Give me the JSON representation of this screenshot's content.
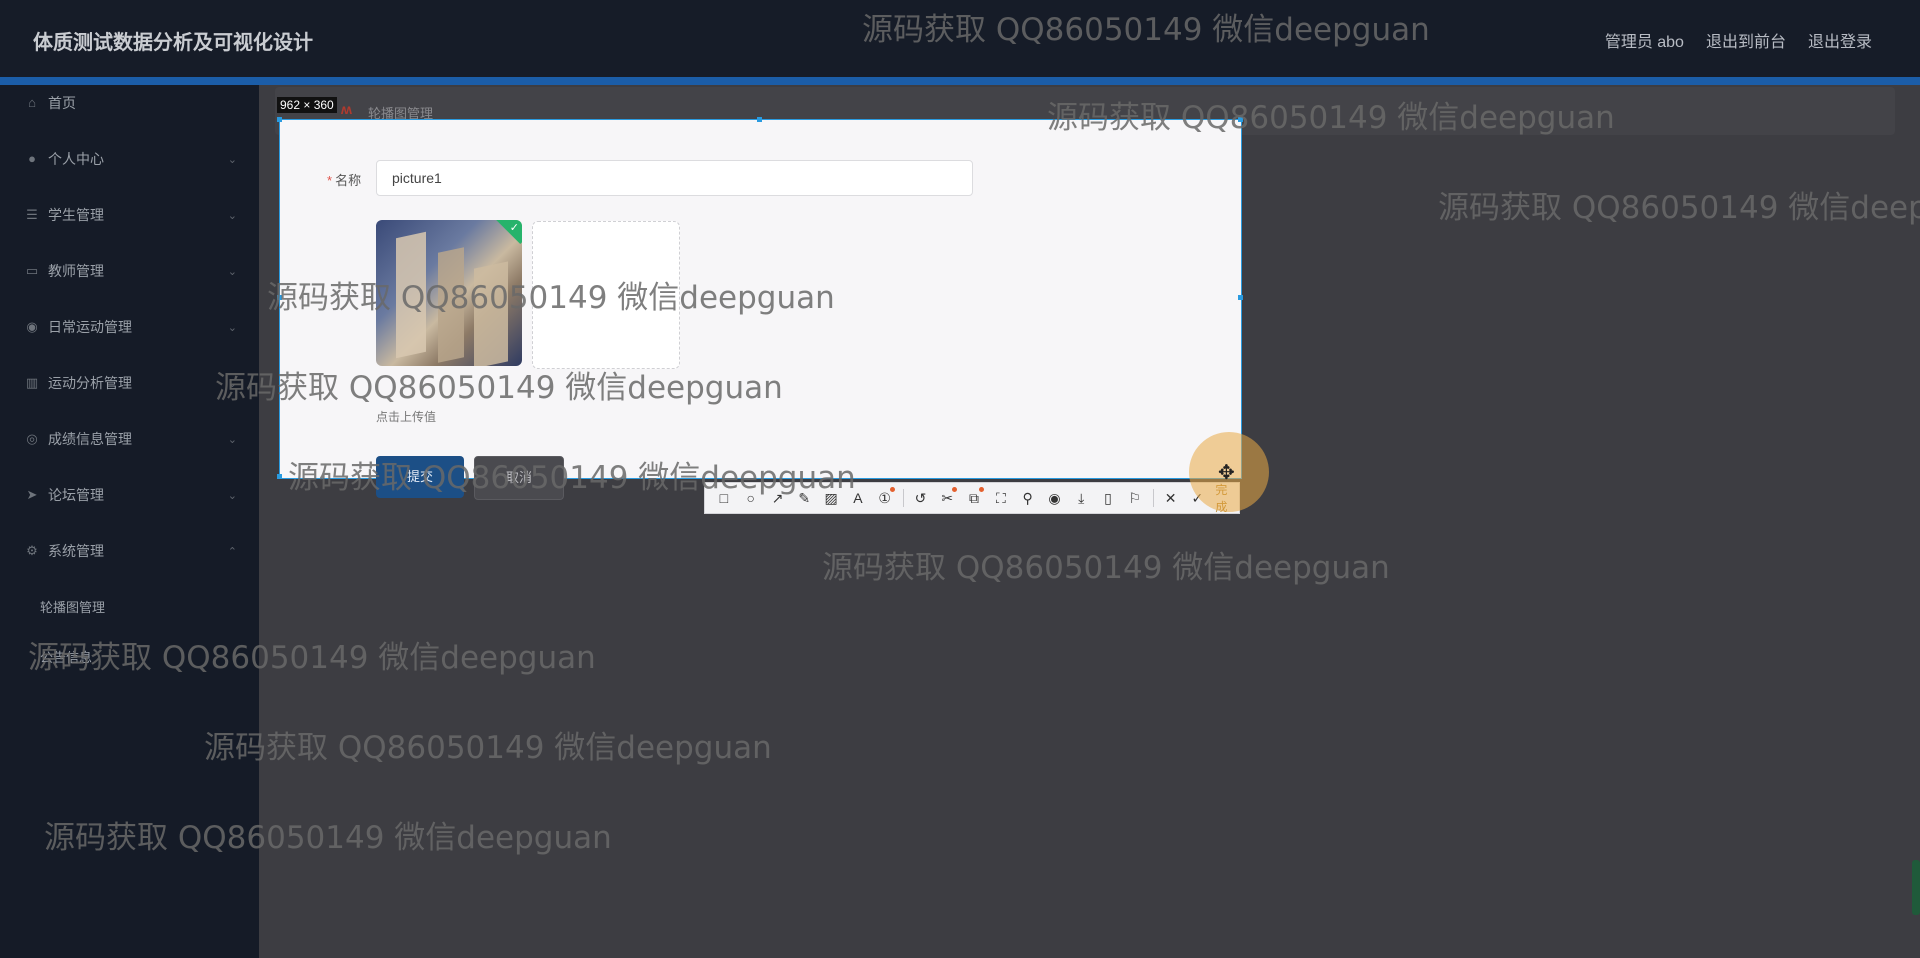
{
  "header": {
    "title": "体质测试数据分析及可视化设计",
    "links": [
      "管理员 abo",
      "退出到前台",
      "退出登录"
    ]
  },
  "sidebar": {
    "items": [
      {
        "label": "首页",
        "icon": "home-icon",
        "chevron": false
      },
      {
        "label": "个人中心",
        "icon": "user-icon",
        "chevron": true
      },
      {
        "label": "学生管理",
        "icon": "list-icon",
        "chevron": true
      },
      {
        "label": "教师管理",
        "icon": "monitor-icon",
        "chevron": true
      },
      {
        "label": "日常运动管理",
        "icon": "location-icon",
        "chevron": true
      },
      {
        "label": "运动分析管理",
        "icon": "chart-icon",
        "chevron": true
      },
      {
        "label": "成绩信息管理",
        "icon": "compass-icon",
        "chevron": true
      },
      {
        "label": "论坛管理",
        "icon": "send-icon",
        "chevron": true
      },
      {
        "label": "系统管理",
        "icon": "gear-icon",
        "chevron": true
      }
    ],
    "sub_items": [
      "轮播图管理",
      "公告信息"
    ]
  },
  "breadcrumb": {
    "text": "轮播图管理"
  },
  "capture": {
    "size_label": "962 × 360"
  },
  "form": {
    "name_label": "名称",
    "name_value": "picture1",
    "upload_hint": "点击上传值",
    "submit_label": "提交",
    "cancel_label": "取消"
  },
  "toolbar": {
    "done_label": "完成"
  },
  "watermark": "源码获取 QQ86050149 微信deepguan",
  "colors": {
    "header_bg": "#161c28",
    "accent_bar": "#1b5da8",
    "sidebar_bg": "#151b27",
    "selection": "#2a9be0",
    "success": "#27b36b"
  }
}
